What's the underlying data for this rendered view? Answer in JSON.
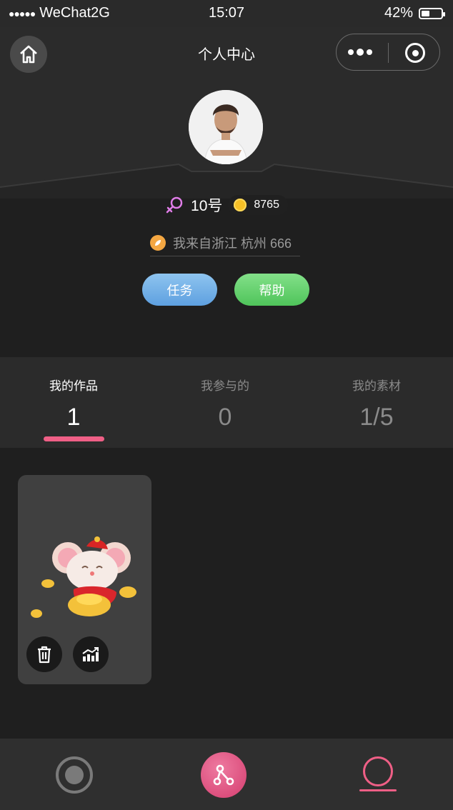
{
  "status_bar": {
    "carrier": "WeChat2G",
    "time": "15:07",
    "battery_percent": "42%",
    "battery_level": 0.42
  },
  "header": {
    "title": "个人中心",
    "home_icon": "home-icon",
    "more_icon": "more-dots-icon",
    "close_icon": "target-circle-icon"
  },
  "profile": {
    "gender_icon": "female-icon",
    "nickname": "10号",
    "coins": "8765",
    "location": "我来自浙江 杭州 666",
    "colors": {
      "gender": "#e07de8",
      "coin": "#f6c026",
      "location_icon": "#f4a742"
    }
  },
  "actions": {
    "task_label": "任务",
    "help_label": "帮助"
  },
  "stats": [
    {
      "label": "我的作品",
      "value": "1"
    },
    {
      "label": "我参与的",
      "value": "0"
    },
    {
      "label": "我的素材",
      "value": "1/5"
    }
  ],
  "works": [
    {
      "image": "mouse-with-gold-ingots",
      "delete_icon": "trash-icon",
      "stats_icon": "chart-trend-icon"
    }
  ],
  "tabbar": {
    "accent": "#ef5f86",
    "items": [
      "home-tab-icon",
      "create-tab-icon",
      "profile-tab-icon"
    ]
  }
}
